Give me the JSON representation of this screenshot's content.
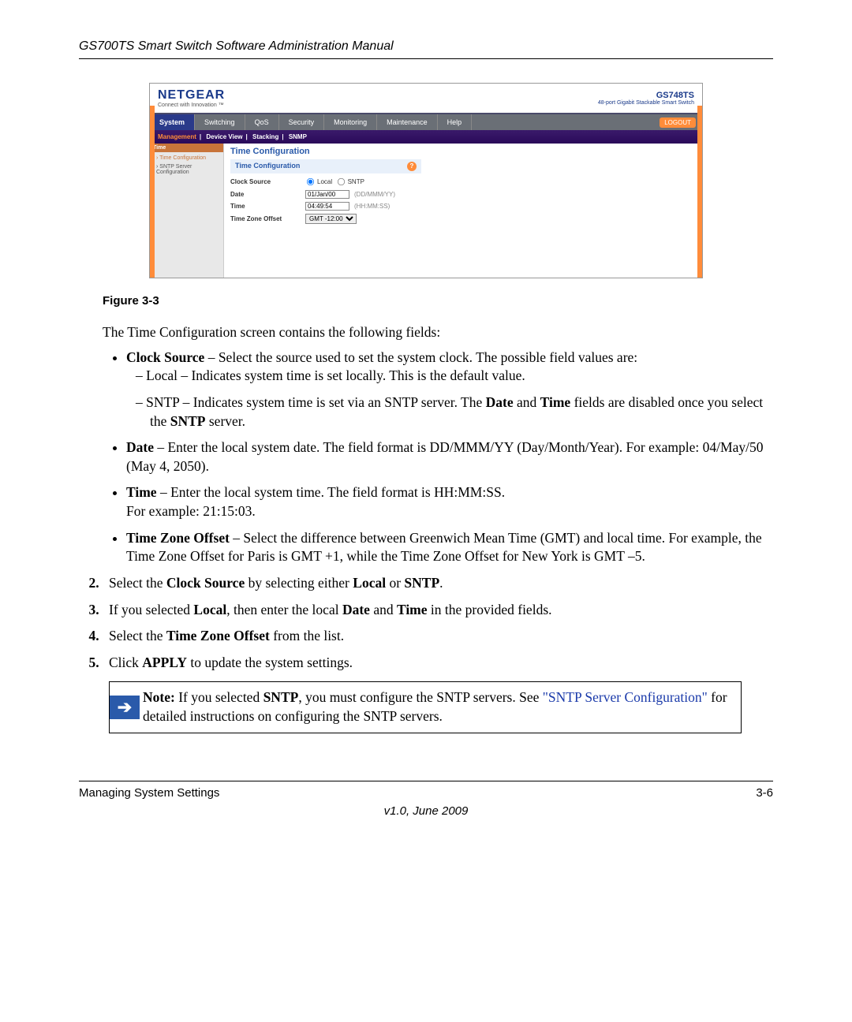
{
  "header": "GS700TS Smart Switch Software Administration Manual",
  "screenshot": {
    "logo": "NETGEAR",
    "logo_sub": "Connect with Innovation ™",
    "device_title": "GS748TS",
    "device_sub": "48-port Gigabit Stackable Smart Switch",
    "tabs": [
      "System",
      "Switching",
      "QoS",
      "Security",
      "Monitoring",
      "Maintenance",
      "Help"
    ],
    "logout": "LOGOUT",
    "subtabs": {
      "a": "Management",
      "b": "Device View",
      "c": "Stacking",
      "d": "SNMP"
    },
    "sidebar": {
      "head": "Time",
      "item1": "Time Configuration",
      "item2": "SNTP Server Configuration"
    },
    "main_title": "Time Configuration",
    "panel_title": "Time Configuration",
    "rows": {
      "clock_source_label": "Clock Source",
      "clock_source_opt1": "Local",
      "clock_source_opt2": "SNTP",
      "date_label": "Date",
      "date_value": "01/Jan/00",
      "date_hint": "(DD/MMM/YY)",
      "time_label": "Time",
      "time_value": "04:49:54",
      "time_hint": "(HH:MM:SS)",
      "tz_label": "Time Zone Offset",
      "tz_value": "GMT -12:00"
    }
  },
  "figure_caption": "Figure 3-3",
  "intro": "The Time Configuration screen contains the following fields:",
  "b1": {
    "label": "Clock Source",
    "text": " – Select the source used to set the system clock. The possible field values are:"
  },
  "b1a": "Local – Indicates system time is set locally. This is the default value.",
  "b1b": {
    "pre": "SNTP – Indicates system time is set via an SNTP server. The ",
    "b1": "Date",
    "mid": " and ",
    "b2": "Time",
    "post": " fields are disabled once you select the ",
    "b3": "SNTP",
    "end": " server."
  },
  "b2": {
    "label": "Date",
    "text": " – Enter the local system date. The field format is DD/MMM/YY (Day/Month/Year). For example: 04/May/50 (May 4, 2050)."
  },
  "b3": {
    "label": "Time",
    "text": " – Enter the local system time. The field format is HH:MM:SS.",
    "br": "For example: 21:15:03."
  },
  "b4": {
    "label": "Time Zone Offset",
    "text": " – Select the difference between Greenwich Mean Time (GMT) and local time. For example, the Time Zone Offset for Paris is GMT +1, while the Time Zone Offset for New York is GMT –5."
  },
  "s2": {
    "pre": "Select the ",
    "b1": "Clock Source",
    "mid": " by selecting either ",
    "b2": "Local",
    "or": " or ",
    "b3": "SNTP",
    "end": "."
  },
  "s3": {
    "pre": "If you selected ",
    "b1": "Local",
    "mid": ", then enter the local ",
    "b2": "Date",
    "and": " and ",
    "b3": "Time",
    "end": " in the provided fields."
  },
  "s4": {
    "pre": "Select the ",
    "b1": "Time Zone Offset",
    "end": " from the list."
  },
  "s5": {
    "pre": "Click ",
    "b1": "APPLY",
    "end": " to update the system settings."
  },
  "note": {
    "lead": "Note:",
    "pre": " If you selected ",
    "b1": "SNTP",
    "mid": ", you must configure the SNTP servers. See ",
    "link": "\"SNTP Server Configuration\"",
    "post": " for detailed instructions on configuring the SNTP servers."
  },
  "footer": {
    "left": "Managing System Settings",
    "right": "3-6",
    "center": "v1.0, June 2009"
  }
}
